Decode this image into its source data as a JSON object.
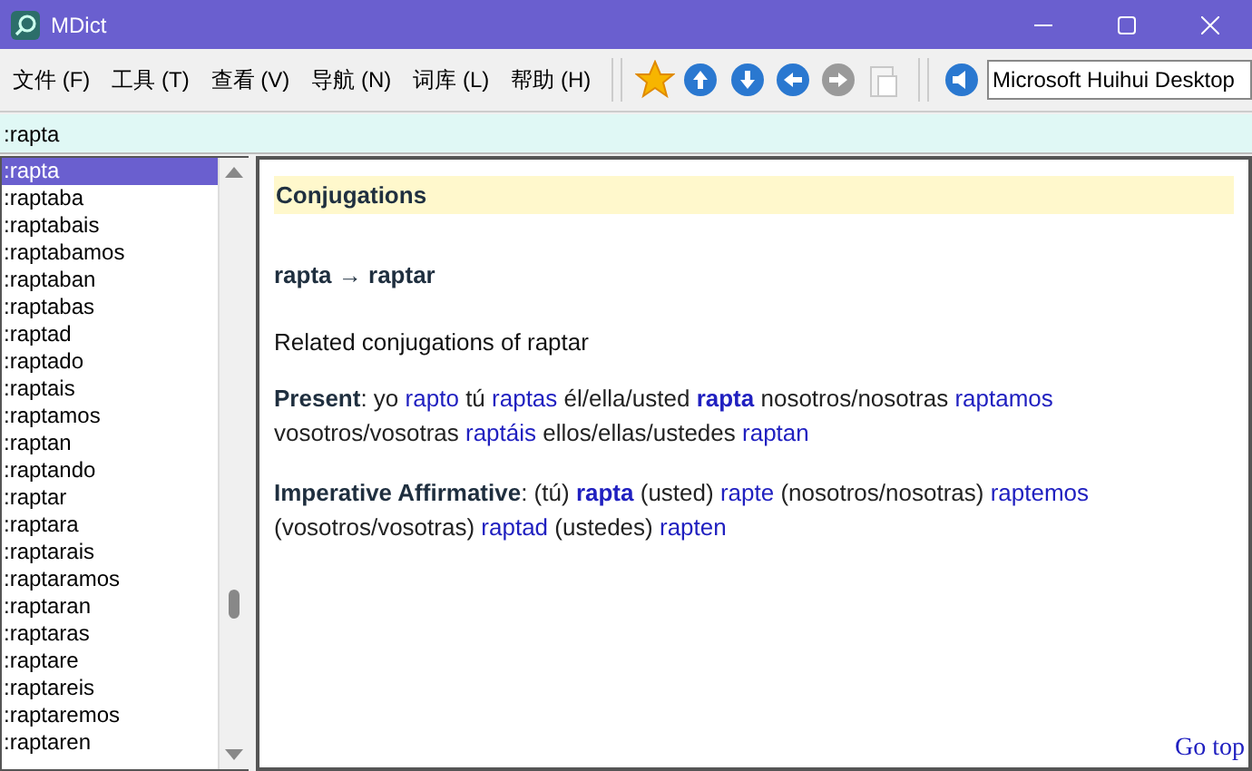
{
  "window": {
    "title": "MDict"
  },
  "menu": [
    {
      "label": "文件 (F)"
    },
    {
      "label": "工具 (T)"
    },
    {
      "label": "查看 (V)"
    },
    {
      "label": "导航 (N)"
    },
    {
      "label": "词库 (L)"
    },
    {
      "label": "帮助 (H)"
    }
  ],
  "toolbar": [
    {
      "kind": "star",
      "disabled": false
    },
    {
      "kind": "up",
      "disabled": false
    },
    {
      "kind": "down",
      "disabled": false
    },
    {
      "kind": "back",
      "disabled": false
    },
    {
      "kind": "forward",
      "disabled": true
    },
    {
      "kind": "paste",
      "disabled": true
    }
  ],
  "voice": {
    "value": "Microsoft Huihui Desktop"
  },
  "search": {
    "value": ":rapta"
  },
  "word_list": [
    {
      "label": ":rapta",
      "selected": true
    },
    {
      "label": ":raptaba",
      "selected": false
    },
    {
      "label": ":raptabais",
      "selected": false
    },
    {
      "label": ":raptabamos",
      "selected": false
    },
    {
      "label": ":raptaban",
      "selected": false
    },
    {
      "label": ":raptabas",
      "selected": false
    },
    {
      "label": ":raptad",
      "selected": false
    },
    {
      "label": ":raptado",
      "selected": false
    },
    {
      "label": ":raptais",
      "selected": false
    },
    {
      "label": ":raptamos",
      "selected": false
    },
    {
      "label": ":raptan",
      "selected": false
    },
    {
      "label": ":raptando",
      "selected": false
    },
    {
      "label": ":raptar",
      "selected": false
    },
    {
      "label": ":raptara",
      "selected": false
    },
    {
      "label": ":raptarais",
      "selected": false
    },
    {
      "label": ":raptaramos",
      "selected": false
    },
    {
      "label": ":raptaran",
      "selected": false
    },
    {
      "label": ":raptaras",
      "selected": false
    },
    {
      "label": ":raptare",
      "selected": false
    },
    {
      "label": ":raptareis",
      "selected": false
    },
    {
      "label": ":raptaremos",
      "selected": false
    },
    {
      "label": ":raptaren",
      "selected": false
    }
  ],
  "entry": {
    "heading": "Conjugations",
    "headword": "rapta → raptar",
    "intro": "Related conjugations of raptar",
    "sections": [
      {
        "label": "Present",
        "segments": [
          {
            "kind": "text",
            "text": ": yo"
          },
          {
            "kind": "link",
            "text": "rapto",
            "bold": false
          },
          {
            "kind": "text",
            "text": "tú"
          },
          {
            "kind": "link",
            "text": "raptas",
            "bold": false
          },
          {
            "kind": "text",
            "text": "él/ella/usted"
          },
          {
            "kind": "link",
            "text": "rapta",
            "bold": true
          },
          {
            "kind": "text",
            "text": "nosotros/nosotras"
          },
          {
            "kind": "link",
            "text": "raptamos",
            "bold": false
          },
          {
            "kind": "text",
            "text": "vosotros/vosotras"
          },
          {
            "kind": "link",
            "text": "raptáis",
            "bold": false
          },
          {
            "kind": "text",
            "text": "ellos/ellas/ustedes"
          },
          {
            "kind": "link",
            "text": "raptan",
            "bold": false
          }
        ]
      },
      {
        "label": "Imperative Affirmative",
        "segments": [
          {
            "kind": "text",
            "text": ": (tú)"
          },
          {
            "kind": "link",
            "text": "rapta",
            "bold": true
          },
          {
            "kind": "text",
            "text": "(usted)"
          },
          {
            "kind": "link",
            "text": "rapte",
            "bold": false
          },
          {
            "kind": "text",
            "text": "(nosotros/nosotras)"
          },
          {
            "kind": "link",
            "text": "raptemos",
            "bold": false
          },
          {
            "kind": "text",
            "text": "(vosotros/vosotras)"
          },
          {
            "kind": "link",
            "text": "raptad",
            "bold": false
          },
          {
            "kind": "text",
            "text": "(ustedes)"
          },
          {
            "kind": "link",
            "text": "rapten",
            "bold": false
          }
        ]
      }
    ]
  },
  "go_top": "Go top"
}
